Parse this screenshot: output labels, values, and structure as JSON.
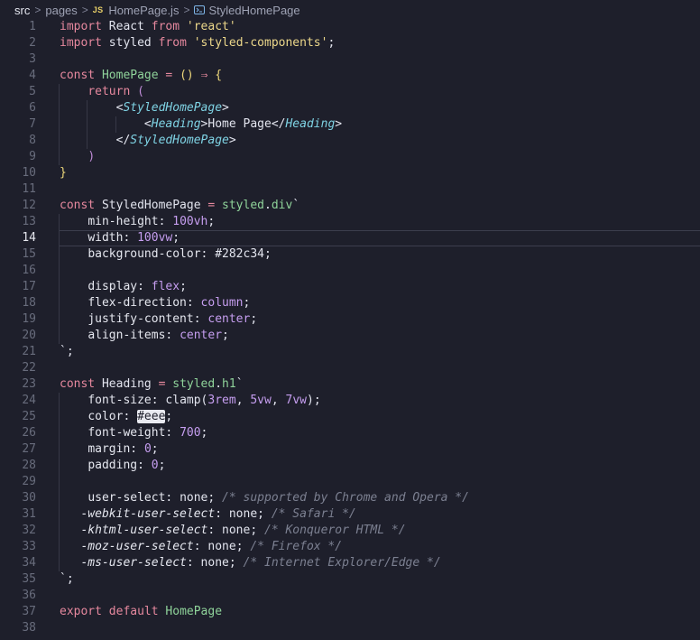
{
  "breadcrumb": {
    "items": [
      "src",
      "pages",
      "HomePage.js",
      "StyledHomePage"
    ],
    "file_badge": "JS"
  },
  "editor": {
    "current_line": 14,
    "lines": [
      {
        "n": 1,
        "indent": 0,
        "tokens": [
          [
            "kw",
            "import"
          ],
          [
            "id",
            " React "
          ],
          [
            "kw",
            "from"
          ],
          [
            "id",
            " "
          ],
          [
            "str",
            "'react'"
          ]
        ]
      },
      {
        "n": 2,
        "indent": 0,
        "tokens": [
          [
            "kw",
            "import"
          ],
          [
            "id",
            " styled "
          ],
          [
            "kw",
            "from"
          ],
          [
            "id",
            " "
          ],
          [
            "str",
            "'styled-components'"
          ],
          [
            "punc",
            ";"
          ]
        ]
      },
      {
        "n": 3,
        "indent": 0,
        "tokens": []
      },
      {
        "n": 4,
        "indent": 0,
        "tokens": [
          [
            "kw",
            "const"
          ],
          [
            "id",
            " "
          ],
          [
            "fn",
            "HomePage"
          ],
          [
            "id",
            " "
          ],
          [
            "op",
            "="
          ],
          [
            "id",
            " "
          ],
          [
            "br",
            "()"
          ],
          [
            "id",
            " "
          ],
          [
            "op",
            "⇒"
          ],
          [
            "id",
            " "
          ],
          [
            "br",
            "{"
          ]
        ]
      },
      {
        "n": 5,
        "indent": 1,
        "tokens": [
          [
            "id",
            "    "
          ],
          [
            "kw",
            "return"
          ],
          [
            "id",
            " "
          ],
          [
            "br2",
            "("
          ]
        ]
      },
      {
        "n": 6,
        "indent": 2,
        "tokens": [
          [
            "id",
            "        "
          ],
          [
            "punc",
            "<"
          ],
          [
            "tag",
            "StyledHomePage"
          ],
          [
            "punc",
            ">"
          ]
        ]
      },
      {
        "n": 7,
        "indent": 3,
        "tokens": [
          [
            "id",
            "            "
          ],
          [
            "punc",
            "<"
          ],
          [
            "tag",
            "Heading"
          ],
          [
            "punc",
            ">"
          ],
          [
            "id",
            "Home Page"
          ],
          [
            "punc",
            "</"
          ],
          [
            "tag",
            "Heading"
          ],
          [
            "punc",
            ">"
          ]
        ]
      },
      {
        "n": 8,
        "indent": 2,
        "tokens": [
          [
            "id",
            "        "
          ],
          [
            "punc",
            "</"
          ],
          [
            "tag",
            "StyledHomePage"
          ],
          [
            "punc",
            ">"
          ]
        ]
      },
      {
        "n": 9,
        "indent": 1,
        "tokens": [
          [
            "id",
            "    "
          ],
          [
            "br2",
            ")"
          ]
        ]
      },
      {
        "n": 10,
        "indent": 0,
        "tokens": [
          [
            "br",
            "}"
          ]
        ]
      },
      {
        "n": 11,
        "indent": 0,
        "tokens": []
      },
      {
        "n": 12,
        "indent": 0,
        "tokens": [
          [
            "kw",
            "const"
          ],
          [
            "id",
            " StyledHomePage "
          ],
          [
            "op",
            "="
          ],
          [
            "id",
            " "
          ],
          [
            "fn",
            "styled"
          ],
          [
            "punc",
            "."
          ],
          [
            "fn",
            "div"
          ],
          [
            "punc",
            "`"
          ]
        ]
      },
      {
        "n": 13,
        "indent": 1,
        "tokens": [
          [
            "id",
            "    "
          ],
          [
            "prop",
            "min-height"
          ],
          [
            "punc",
            ": "
          ],
          [
            "num",
            "100vh"
          ],
          [
            "punc",
            ";"
          ]
        ]
      },
      {
        "n": 14,
        "indent": 1,
        "tokens": [
          [
            "id",
            "    "
          ],
          [
            "prop",
            "width"
          ],
          [
            "punc",
            ": "
          ],
          [
            "num",
            "100vw"
          ],
          [
            "punc",
            ";"
          ]
        ]
      },
      {
        "n": 15,
        "indent": 1,
        "tokens": [
          [
            "id",
            "    "
          ],
          [
            "prop",
            "background-color"
          ],
          [
            "punc",
            ": "
          ],
          [
            "id",
            "#282c34"
          ],
          [
            "punc",
            ";"
          ]
        ]
      },
      {
        "n": 16,
        "indent": 1,
        "tokens": []
      },
      {
        "n": 17,
        "indent": 1,
        "tokens": [
          [
            "id",
            "    "
          ],
          [
            "prop",
            "display"
          ],
          [
            "punc",
            ": "
          ],
          [
            "val",
            "flex"
          ],
          [
            "punc",
            ";"
          ]
        ]
      },
      {
        "n": 18,
        "indent": 1,
        "tokens": [
          [
            "id",
            "    "
          ],
          [
            "prop",
            "flex-direction"
          ],
          [
            "punc",
            ": "
          ],
          [
            "val",
            "column"
          ],
          [
            "punc",
            ";"
          ]
        ]
      },
      {
        "n": 19,
        "indent": 1,
        "tokens": [
          [
            "id",
            "    "
          ],
          [
            "prop",
            "justify-content"
          ],
          [
            "punc",
            ": "
          ],
          [
            "val",
            "center"
          ],
          [
            "punc",
            ";"
          ]
        ]
      },
      {
        "n": 20,
        "indent": 1,
        "tokens": [
          [
            "id",
            "    "
          ],
          [
            "prop",
            "align-items"
          ],
          [
            "punc",
            ": "
          ],
          [
            "val",
            "center"
          ],
          [
            "punc",
            ";"
          ]
        ]
      },
      {
        "n": 21,
        "indent": 0,
        "tokens": [
          [
            "punc",
            "`;"
          ]
        ]
      },
      {
        "n": 22,
        "indent": 0,
        "tokens": []
      },
      {
        "n": 23,
        "indent": 0,
        "tokens": [
          [
            "kw",
            "const"
          ],
          [
            "id",
            " Heading "
          ],
          [
            "op",
            "="
          ],
          [
            "id",
            " "
          ],
          [
            "fn",
            "styled"
          ],
          [
            "punc",
            "."
          ],
          [
            "fn",
            "h1"
          ],
          [
            "punc",
            "`"
          ]
        ]
      },
      {
        "n": 24,
        "indent": 1,
        "tokens": [
          [
            "id",
            "    "
          ],
          [
            "prop",
            "font-size"
          ],
          [
            "punc",
            ": "
          ],
          [
            "id",
            "clamp("
          ],
          [
            "num",
            "3rem"
          ],
          [
            "punc",
            ", "
          ],
          [
            "num",
            "5vw"
          ],
          [
            "punc",
            ", "
          ],
          [
            "num",
            "7vw"
          ],
          [
            "id",
            ")"
          ],
          [
            "punc",
            ";"
          ]
        ]
      },
      {
        "n": 25,
        "indent": 1,
        "tokens": [
          [
            "id",
            "    "
          ],
          [
            "prop",
            "color"
          ],
          [
            "punc",
            ": "
          ],
          [
            "hl",
            "#eee"
          ],
          [
            "punc",
            ";"
          ]
        ]
      },
      {
        "n": 26,
        "indent": 1,
        "tokens": [
          [
            "id",
            "    "
          ],
          [
            "prop",
            "font-weight"
          ],
          [
            "punc",
            ": "
          ],
          [
            "num",
            "700"
          ],
          [
            "punc",
            ";"
          ]
        ]
      },
      {
        "n": 27,
        "indent": 1,
        "tokens": [
          [
            "id",
            "    "
          ],
          [
            "prop",
            "margin"
          ],
          [
            "punc",
            ": "
          ],
          [
            "num",
            "0"
          ],
          [
            "punc",
            ";"
          ]
        ]
      },
      {
        "n": 28,
        "indent": 1,
        "tokens": [
          [
            "id",
            "    "
          ],
          [
            "prop",
            "padding"
          ],
          [
            "punc",
            ": "
          ],
          [
            "num",
            "0"
          ],
          [
            "punc",
            ";"
          ]
        ]
      },
      {
        "n": 29,
        "indent": 1,
        "tokens": []
      },
      {
        "n": 30,
        "indent": 1,
        "tokens": [
          [
            "id",
            "    "
          ],
          [
            "prop",
            "user-select"
          ],
          [
            "punc",
            ": "
          ],
          [
            "id",
            "none"
          ],
          [
            "punc",
            "; "
          ],
          [
            "cm",
            "/* supported by Chrome and Opera */"
          ]
        ]
      },
      {
        "n": 31,
        "indent": 1,
        "tokens": [
          [
            "id",
            "   "
          ],
          [
            "vend",
            "-webkit-user-select"
          ],
          [
            "punc",
            ": "
          ],
          [
            "id",
            "none"
          ],
          [
            "punc",
            "; "
          ],
          [
            "cm",
            "/* Safari */"
          ]
        ]
      },
      {
        "n": 32,
        "indent": 1,
        "tokens": [
          [
            "id",
            "   "
          ],
          [
            "vend",
            "-khtml-user-select"
          ],
          [
            "punc",
            ": "
          ],
          [
            "id",
            "none"
          ],
          [
            "punc",
            "; "
          ],
          [
            "cm",
            "/* Konqueror HTML */"
          ]
        ]
      },
      {
        "n": 33,
        "indent": 1,
        "tokens": [
          [
            "id",
            "   "
          ],
          [
            "vend",
            "-moz-user-select"
          ],
          [
            "punc",
            ": "
          ],
          [
            "id",
            "none"
          ],
          [
            "punc",
            "; "
          ],
          [
            "cm",
            "/* Firefox */"
          ]
        ]
      },
      {
        "n": 34,
        "indent": 1,
        "tokens": [
          [
            "id",
            "   "
          ],
          [
            "vend",
            "-ms-user-select"
          ],
          [
            "punc",
            ": "
          ],
          [
            "id",
            "none"
          ],
          [
            "punc",
            "; "
          ],
          [
            "cm",
            "/* Internet Explorer/Edge */"
          ]
        ]
      },
      {
        "n": 35,
        "indent": 0,
        "tokens": [
          [
            "punc",
            "`;"
          ]
        ]
      },
      {
        "n": 36,
        "indent": 0,
        "tokens": []
      },
      {
        "n": 37,
        "indent": 0,
        "tokens": [
          [
            "kw",
            "export"
          ],
          [
            "id",
            " "
          ],
          [
            "kw",
            "default"
          ],
          [
            "id",
            " "
          ],
          [
            "fn",
            "HomePage"
          ]
        ]
      },
      {
        "n": 38,
        "indent": 0,
        "tokens": []
      }
    ]
  }
}
